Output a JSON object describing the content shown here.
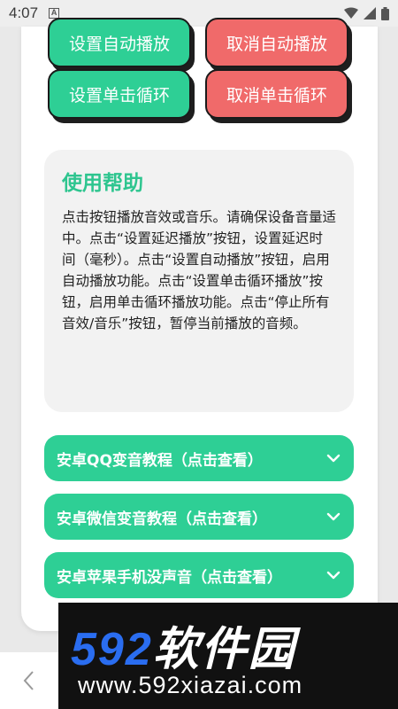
{
  "status_bar": {
    "time": "4:07",
    "notif_letter": "A"
  },
  "buttons": {
    "set_auto_play": "设置自动播放",
    "cancel_auto_play": "取消自动播放",
    "set_single_loop": "设置单击循环",
    "cancel_single_loop": "取消单击循环"
  },
  "help": {
    "title": "使用帮助",
    "body": "点击按钮播放音效或音乐。请确保设备音量适中。点击“设置延迟播放”按钮，设置延迟时间（毫秒）。点击“设置自动播放”按钮，启用自动播放功能。点击“设置单击循环播放”按钮，启用单击循环播放功能。点击“停止所有音效/音乐”按钮，暂停当前播放的音频。"
  },
  "folds": [
    {
      "label": "安卓QQ变音教程（点击查看）"
    },
    {
      "label": "安卓微信变音教程（点击查看）"
    },
    {
      "label": "安卓苹果手机没声音（点击查看）"
    }
  ],
  "watermark": {
    "logo_num": "592",
    "logo_cn": "软件园",
    "url": "www.592xiazai.com"
  },
  "colors": {
    "green": "#2ecf95",
    "red": "#f06a6a",
    "title_green": "#2ec58f"
  }
}
